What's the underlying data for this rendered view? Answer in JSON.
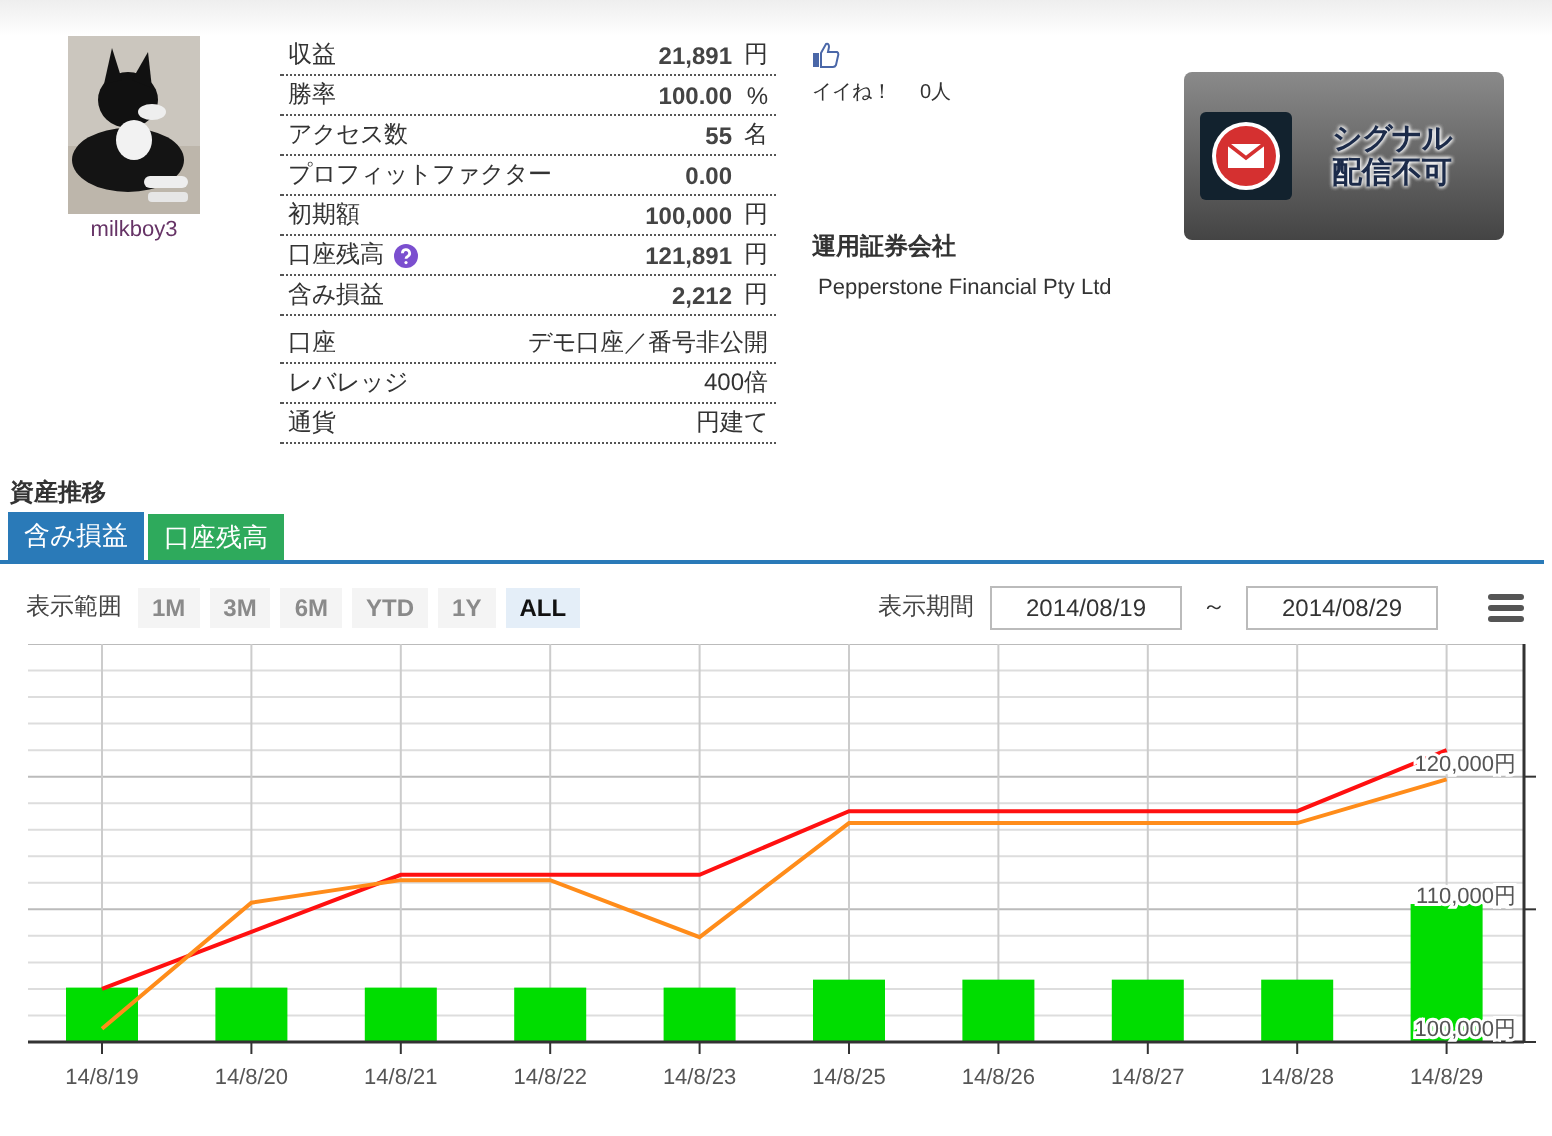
{
  "user": {
    "name": "milkboy3"
  },
  "stats": [
    {
      "label": "収益",
      "value": "21,891",
      "unit": "円",
      "help": false
    },
    {
      "label": "勝率",
      "value": "100.00",
      "unit": "%",
      "help": false
    },
    {
      "label": "アクセス数",
      "value": "55",
      "unit": "名",
      "help": false
    },
    {
      "label": "プロフィットファクター",
      "value": "0.00",
      "help": false
    },
    {
      "label": "初期額",
      "value": "100,000",
      "unit": "円",
      "help": false
    },
    {
      "label": "口座残高",
      "value": "121,891",
      "unit": "円",
      "help": true
    },
    {
      "label": "含み損益",
      "value": "2,212",
      "unit": "円",
      "help": false
    }
  ],
  "account": [
    {
      "label": "口座",
      "value": "デモ口座／番号非公開"
    },
    {
      "label": "レバレッジ",
      "value": "400倍"
    },
    {
      "label": "通貨",
      "value": "円建て"
    }
  ],
  "like": {
    "label": "イイね！",
    "count": "0人"
  },
  "signal": {
    "line_1": "シグナル",
    "line_2": "配信不可"
  },
  "broker": {
    "heading": "運用証券会社",
    "name": "Pepperstone Financial Pty Ltd"
  },
  "section_title": "資産推移",
  "tabs": [
    {
      "label": "含み損益",
      "selected": true,
      "color": "#2a7ab8"
    },
    {
      "label": "口座残高",
      "selected": false,
      "color": "#2eaa5c"
    }
  ],
  "range": {
    "label": "表示範囲",
    "options": [
      {
        "label": "1M",
        "selected": false
      },
      {
        "label": "3M",
        "selected": false
      },
      {
        "label": "6M",
        "selected": false
      },
      {
        "label": "YTD",
        "selected": false
      },
      {
        "label": "1Y",
        "selected": false
      },
      {
        "label": "ALL",
        "selected": true
      }
    ]
  },
  "period": {
    "label": "表示期間",
    "from": "2014/08/19",
    "separator": "～",
    "to": "2014/08/29"
  },
  "chart_data": {
    "type": "line",
    "categories": [
      "14/8/19",
      "14/8/20",
      "14/8/21",
      "14/8/22",
      "14/8/23",
      "14/8/25",
      "14/8/26",
      "14/8/27",
      "14/8/28",
      "14/8/29"
    ],
    "ylim": [
      100000,
      130000
    ],
    "grid": true,
    "yticks": [
      {
        "value": 100000,
        "label": "100,000円"
      },
      {
        "value": 110000,
        "label": "110,000円"
      },
      {
        "value": 120000,
        "label": "120,000円"
      }
    ],
    "series": [
      {
        "type": "bar",
        "color": "#00dd00",
        "values": [
          104100,
          104100,
          104100,
          104100,
          104100,
          104700,
          104700,
          104700,
          104700,
          110400
        ]
      },
      {
        "color": "#ff1010",
        "values": [
          104000,
          108300,
          112600,
          112600,
          112600,
          117400,
          117400,
          117400,
          117400,
          122000
        ]
      },
      {
        "color": "#ff8c1a",
        "values": [
          101000,
          110500,
          112200,
          112200,
          107900,
          116500,
          116500,
          116500,
          116500,
          119800
        ]
      }
    ]
  }
}
